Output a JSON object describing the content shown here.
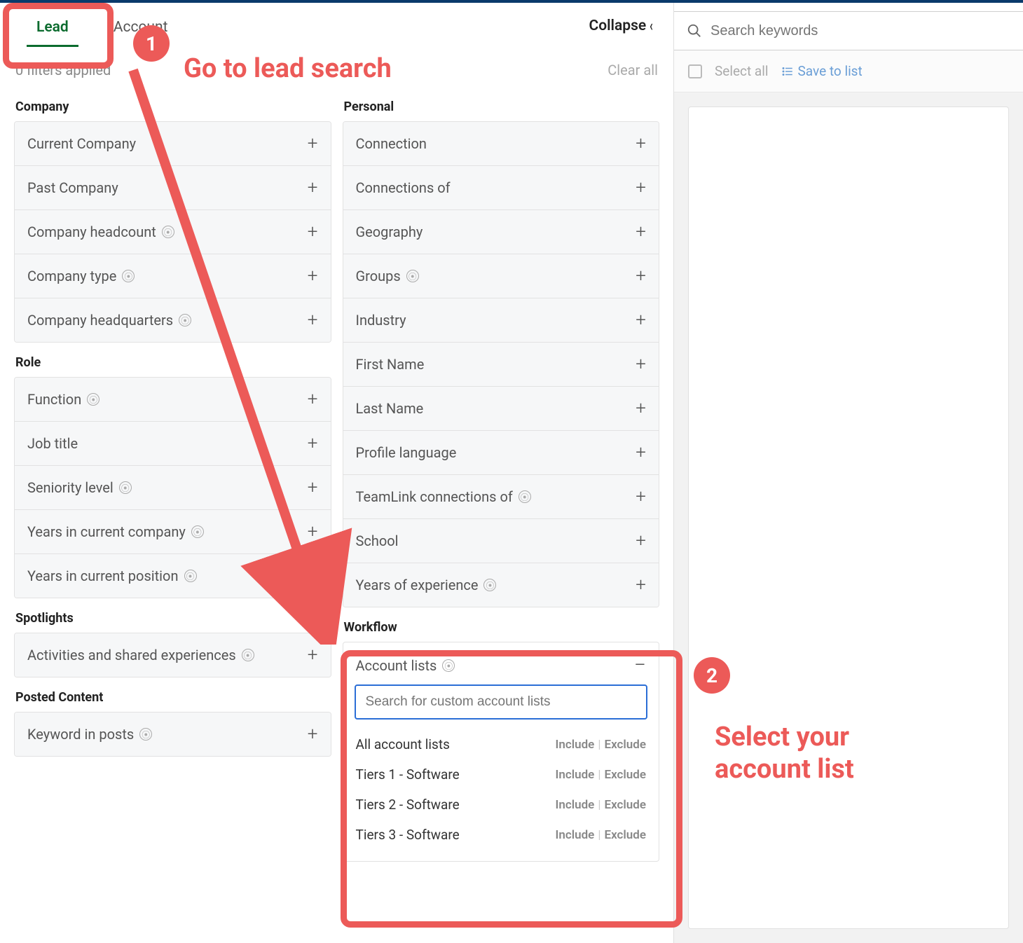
{
  "tabs": {
    "lead": "Lead",
    "account": "Account"
  },
  "collapse_label": "Collapse",
  "filters_applied": "0 filters applied",
  "clear_all": "Clear all",
  "sections": {
    "company": {
      "heading": "Company",
      "items": [
        "Current Company",
        "Past Company",
        "Company headcount",
        "Company type",
        "Company headquarters"
      ]
    },
    "role": {
      "heading": "Role",
      "items": [
        "Function",
        "Job title",
        "Seniority level",
        "Years in current company",
        "Years in current position"
      ]
    },
    "spotlights": {
      "heading": "Spotlights",
      "items": [
        "Activities and shared experiences"
      ]
    },
    "posted": {
      "heading": "Posted Content",
      "items": [
        "Keyword in posts"
      ]
    },
    "personal": {
      "heading": "Personal",
      "items": [
        "Connection",
        "Connections of",
        "Geography",
        "Groups",
        "Industry",
        "First Name",
        "Last Name",
        "Profile language",
        "TeamLink connections of",
        "School",
        "Years of experience"
      ]
    },
    "workflow": {
      "heading": "Workflow",
      "expanded_label": "Account lists",
      "search_placeholder": "Search for custom account lists",
      "options": [
        "All account lists",
        "Tiers 1 - Software",
        "Tiers 2 - Software",
        "Tiers 3 - Software"
      ],
      "include": "Include",
      "exclude": "Exclude"
    }
  },
  "right": {
    "search_placeholder": "Search keywords",
    "select_all": "Select all",
    "save_to_list": "Save to list"
  },
  "annotations": {
    "step1_num": "1",
    "step1_text": "Go to lead search",
    "step2_num": "2",
    "step2_text": "Select your\naccount list"
  }
}
